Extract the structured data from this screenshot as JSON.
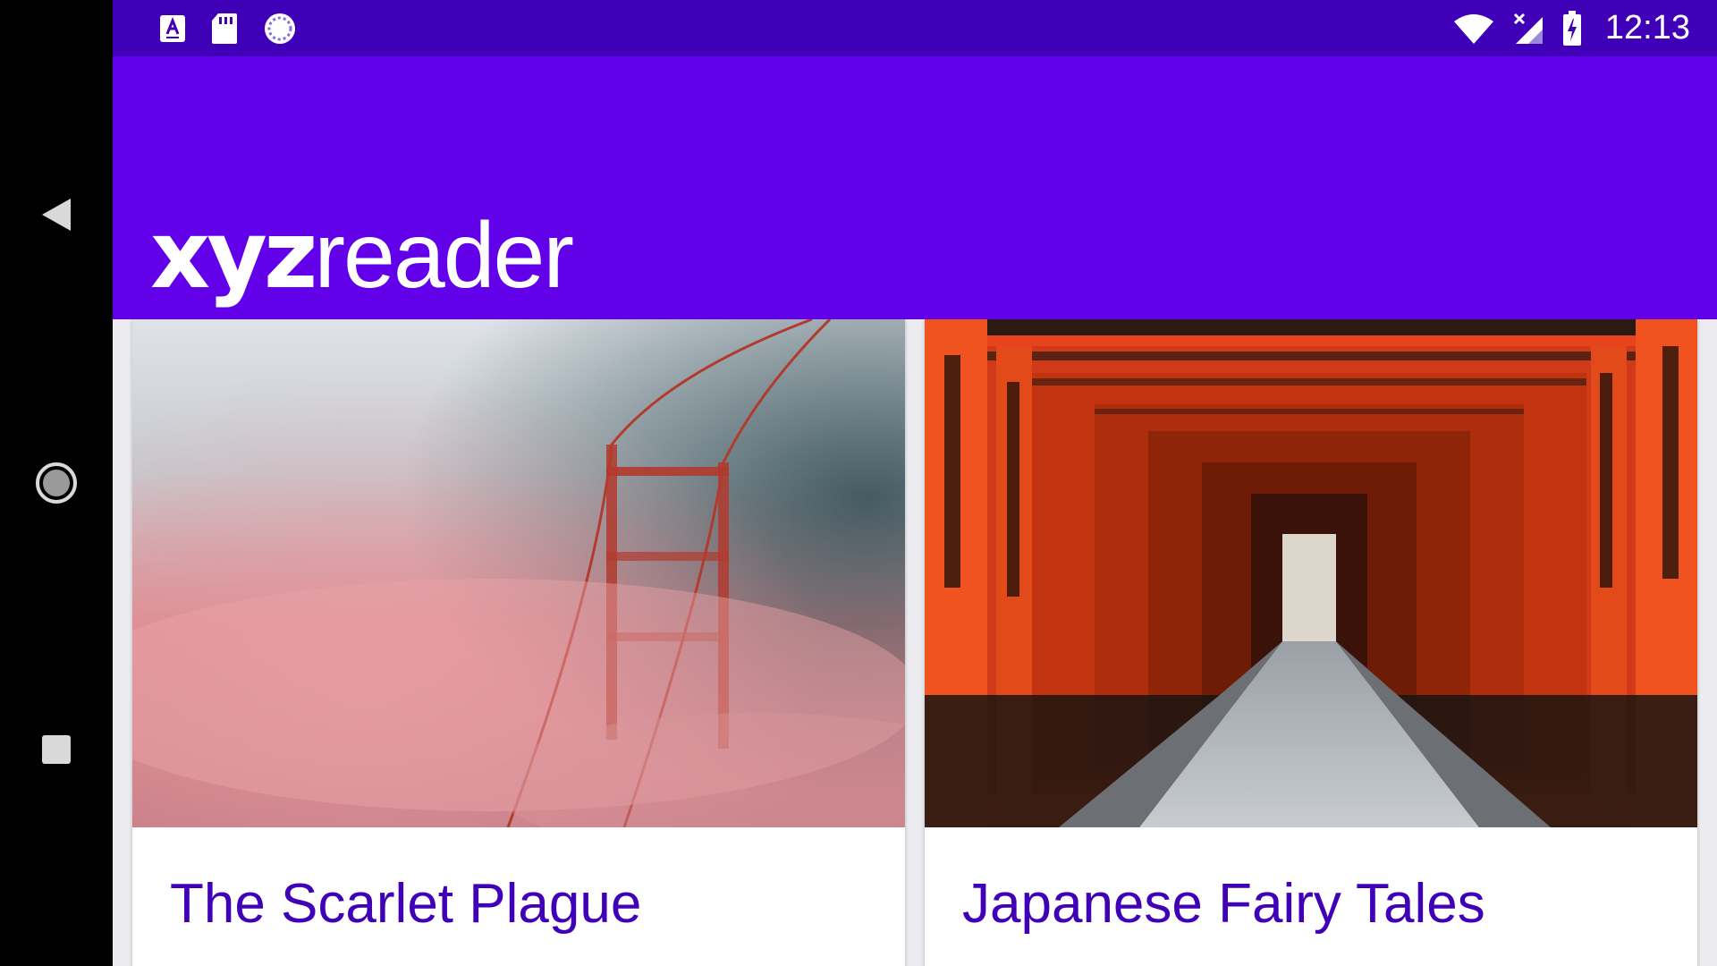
{
  "status_bar": {
    "left_icons": [
      "keyboard-a-icon",
      "sd-card-icon",
      "sync-circle-icon"
    ],
    "right_icons": [
      "wifi-icon",
      "cell-signal-no-service-icon",
      "battery-charging-icon"
    ],
    "time": "12:13",
    "color": "#3f00b8"
  },
  "app_bar": {
    "logo_bold": "xyz",
    "logo_light": "reader",
    "color": "#6200ea"
  },
  "navigation": {
    "icons": [
      "back-triangle-icon",
      "home-circle-icon",
      "recents-square-icon"
    ]
  },
  "articles": [
    {
      "title": "The Scarlet Plague",
      "image": "golden-gate-bridge-in-pink-fog"
    },
    {
      "title": "Japanese Fairy Tales",
      "image": "red-torii-gates-corridor"
    }
  ],
  "colors": {
    "title_text": "#3f00b8",
    "background": "#ececf0"
  }
}
